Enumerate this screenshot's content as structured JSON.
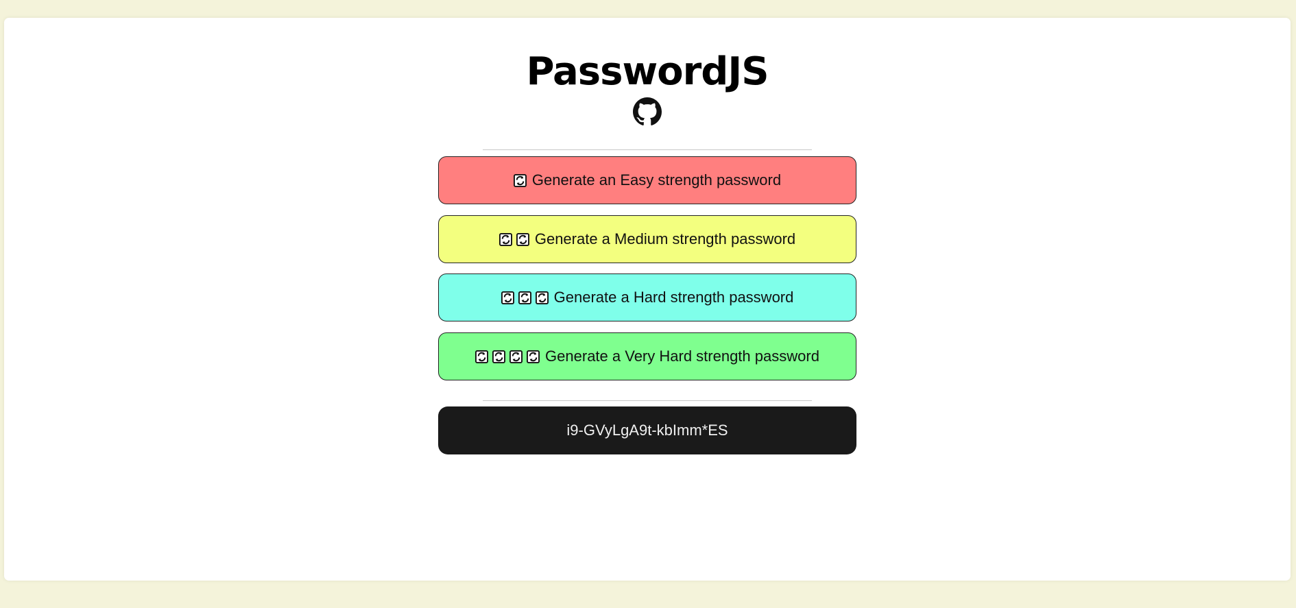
{
  "app": {
    "title": "PasswordJS"
  },
  "header": {
    "github_icon": "github-icon"
  },
  "buttons": [
    {
      "label": "Generate an Easy strength password",
      "icon": "recycle-icon",
      "icon_count": 1,
      "color": "#ff7f7f"
    },
    {
      "label": "Generate a Medium strength password",
      "icon": "recycle-icon",
      "icon_count": 2,
      "color": "#f3ff7f"
    },
    {
      "label": "Generate a Hard strength password",
      "icon": "recycle-icon",
      "icon_count": 3,
      "color": "#7fffea"
    },
    {
      "label": "Generate a Very Hard strength password",
      "icon": "recycle-icon",
      "icon_count": 4,
      "color": "#7fff8f"
    }
  ],
  "output": {
    "password": "i9-GVyLgA9t-kbImm*ES"
  },
  "colors": {
    "page_background": "#f4f3da",
    "card_background": "#ffffff",
    "output_background": "#1a1a1a"
  }
}
